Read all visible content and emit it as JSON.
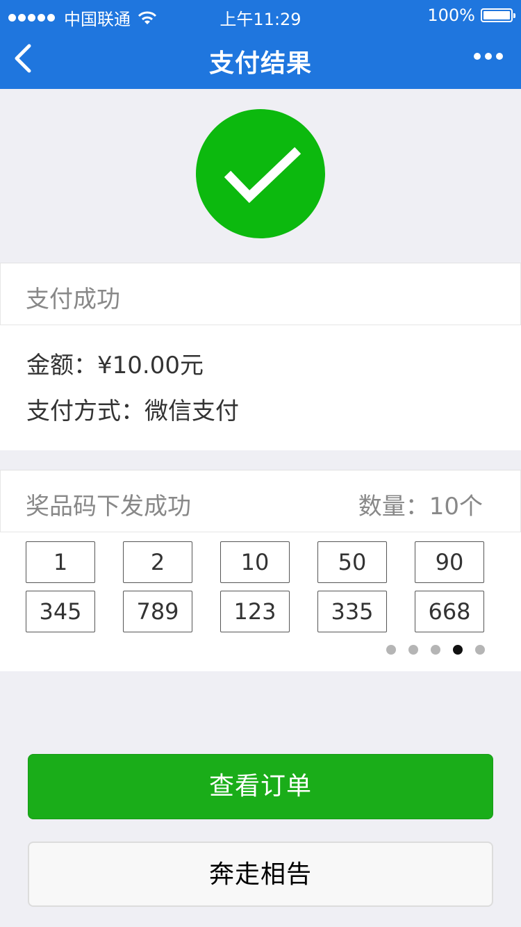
{
  "status_bar": {
    "carrier": "中国联通",
    "time": "上午11:29",
    "battery": "100%"
  },
  "nav": {
    "title": "支付结果",
    "back_icon": "chevron-left-icon",
    "more_icon": "more-dots-icon"
  },
  "result_icon": "checkmark-circle-icon",
  "payment": {
    "header": "支付成功",
    "amount_label": "金额：",
    "amount_value": "¥10.00元",
    "method_label": "支付方式：",
    "method_value": "微信支付"
  },
  "prize": {
    "header": "奖品码下发成功",
    "count_label": "数量：",
    "count_value": "10个",
    "codes": [
      "1",
      "2",
      "10",
      "50",
      "90",
      "345",
      "789",
      "123",
      "335",
      "668"
    ],
    "pager_total": 5,
    "pager_active": 4
  },
  "buttons": {
    "primary": "查看订单",
    "secondary": "奔走相告"
  },
  "colors": {
    "header_bg": "#1f76de",
    "success_green": "#0cb90e",
    "primary_button": "#1aad19"
  }
}
